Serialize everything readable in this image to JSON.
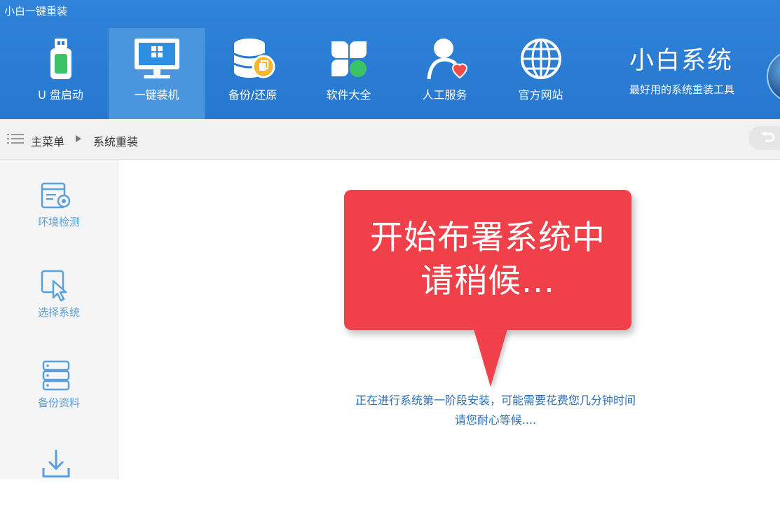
{
  "app": {
    "title": "小白一键重装"
  },
  "nav": {
    "items": [
      {
        "label": "U 盘启动",
        "icon": "usb-drive-icon"
      },
      {
        "label": "一键装机",
        "icon": "monitor-windows-icon",
        "active": true
      },
      {
        "label": "备份/还原",
        "icon": "database-backup-icon"
      },
      {
        "label": "软件大全",
        "icon": "software-grid-icon"
      },
      {
        "label": "人工服务",
        "icon": "support-person-icon"
      },
      {
        "label": "官方网站",
        "icon": "globe-icon"
      }
    ]
  },
  "brand": {
    "name": "小白系统",
    "slogan": "最好用的系统重装工具"
  },
  "breadcrumb": {
    "root": "主菜单",
    "current": "系统重装"
  },
  "sidebar": {
    "items": [
      {
        "label": "环境检测",
        "icon": "environment-check-icon"
      },
      {
        "label": "选择系统",
        "icon": "select-cursor-icon"
      },
      {
        "label": "备份资料",
        "icon": "backup-data-icon"
      },
      {
        "label": "",
        "icon": "download-icon"
      }
    ]
  },
  "main": {
    "callout": {
      "line1": "开始布署系统中",
      "line2": "请稍候..."
    },
    "status_line1": "正在进行系统第一阶段安装，可能需要花费您几分钟时间",
    "status_line2": "请您耐心等候...."
  },
  "colors": {
    "header": "#2778cf",
    "accent": "#5aa0de",
    "callout": "#f04049",
    "status_text": "#2b6fb6"
  }
}
